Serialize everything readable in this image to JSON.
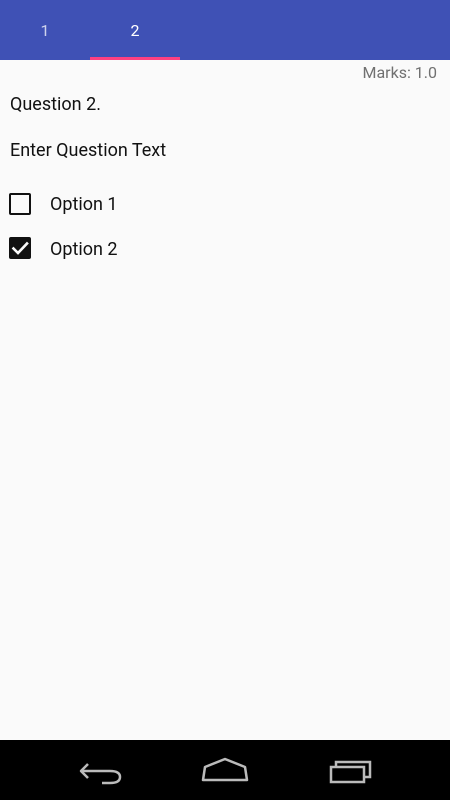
{
  "tabs": [
    {
      "label": "1",
      "active": false
    },
    {
      "label": "2",
      "active": true
    }
  ],
  "marks": "Marks: 1.0",
  "question": {
    "title": "Question 2.",
    "text": "Enter Question Text"
  },
  "options": [
    {
      "label": "Option 1",
      "checked": false
    },
    {
      "label": "Option 2",
      "checked": true
    }
  ],
  "colors": {
    "app_bar": "#3f51b5",
    "tab_indicator": "#ff4081",
    "background": "#fafafa"
  },
  "nav_icons": [
    "back-icon",
    "home-icon",
    "recent-apps-icon"
  ]
}
